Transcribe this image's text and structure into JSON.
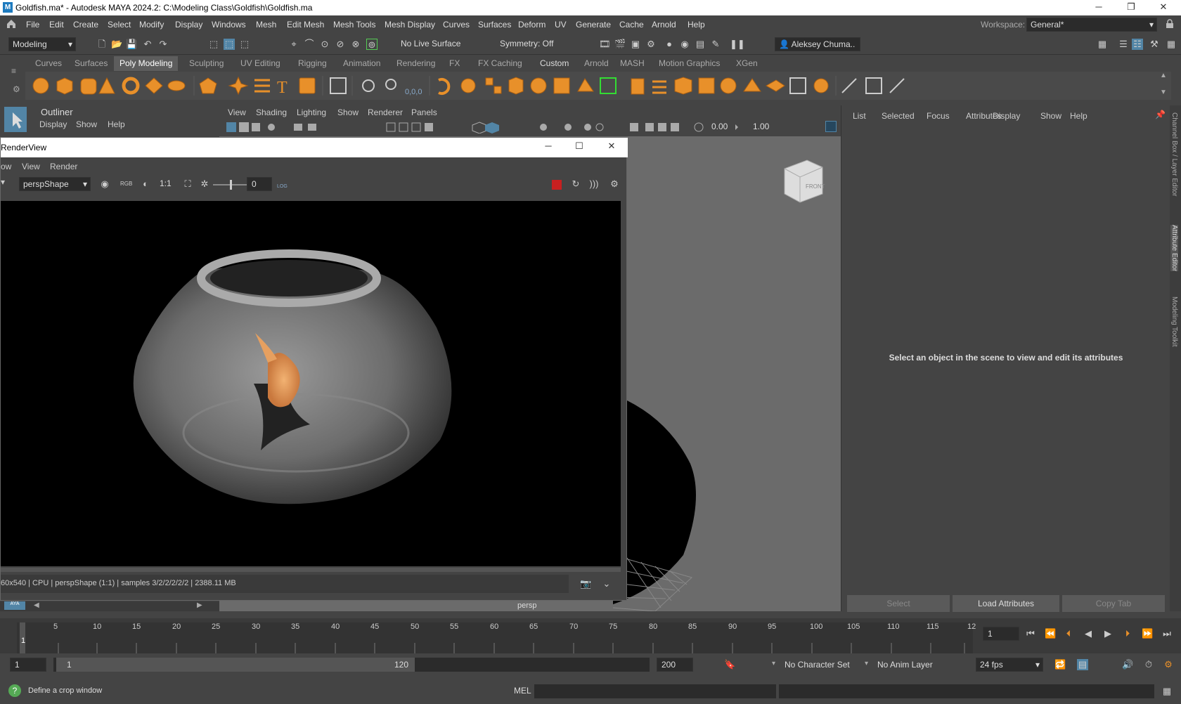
{
  "window": {
    "title": "Goldfish.ma* - Autodesk MAYA 2024.2: C:\\Modeling Class\\Goldfish\\Goldfish.ma",
    "app_icon": "M",
    "minimize": "─",
    "maximize": "❐",
    "close": "✕"
  },
  "menubar": [
    "File",
    "Edit",
    "Create",
    "Select",
    "Modify",
    "Display",
    "Windows",
    "Mesh",
    "Edit Mesh",
    "Mesh Tools",
    "Mesh Display",
    "Curves",
    "Surfaces",
    "Deform",
    "UV",
    "Generate",
    "Cache",
    "Arnold",
    "Help"
  ],
  "workspace": {
    "label": "Workspace:",
    "value": "General*"
  },
  "statusline": {
    "mode": "Modeling",
    "live_surface": "No Live Surface",
    "symmetry": "Symmetry: Off",
    "user": "Aleksey Chuma.."
  },
  "shelf_tabs": [
    "Curves",
    "Surfaces",
    "Poly Modeling",
    "Sculpting",
    "UV Editing",
    "Rigging",
    "Animation",
    "Rendering",
    "FX",
    "FX Caching",
    "Custom",
    "Arnold",
    "MASH",
    "Motion Graphics",
    "XGen"
  ],
  "shelf_active": "Poly Modeling",
  "outliner": {
    "title": "Outliner",
    "menu": [
      "Display",
      "Show",
      "Help"
    ]
  },
  "viewport": {
    "menu": [
      "View",
      "Shading",
      "Lighting",
      "Show",
      "Renderer",
      "Panels"
    ],
    "exposure": "0.00",
    "gamma": "1.00",
    "camera_label": "persp",
    "cube_label": "FRONT"
  },
  "attribute_editor": {
    "menu": [
      "List",
      "Selected",
      "Focus",
      "Attributes",
      "Display",
      "Show",
      "Help"
    ],
    "message": "Select an object in the scene to view and edit its attributes",
    "buttons": [
      "Select",
      "Load Attributes",
      "Copy Tab"
    ]
  },
  "side_tabs": [
    "Channel Box / Layer Editor",
    "Attribute Editor",
    "Modeling Toolkit"
  ],
  "renderview": {
    "title": "RenderView",
    "menu": [
      "ow",
      "View",
      "Render"
    ],
    "camera": "perspShape",
    "ratio": "1:1",
    "exposure": "0",
    "log_label": "LOG",
    "status": "60x540 | CPU | perspShape (1:1) | samples 3/2/2/2/2/2 | 2388.11 MB"
  },
  "timeline": {
    "ticks": [
      "5",
      "10",
      "15",
      "20",
      "25",
      "30",
      "35",
      "40",
      "45",
      "50",
      "55",
      "60",
      "65",
      "70",
      "75",
      "80",
      "85",
      "90",
      "95",
      "100",
      "105",
      "110",
      "115",
      "12"
    ],
    "current_marker": "1",
    "current_frame": "1"
  },
  "range": {
    "start": "1",
    "range_start": "1",
    "range_end": "120",
    "end": "200",
    "character_set": "No Character Set",
    "anim_layer": "No Anim Layer",
    "fps": "24 fps"
  },
  "help_line": {
    "message": "Define a crop window",
    "mel_label": "MEL"
  },
  "colors": {
    "accent": "#5285a6",
    "shelf_orange": "#e8902a",
    "record_red": "#c82020"
  }
}
